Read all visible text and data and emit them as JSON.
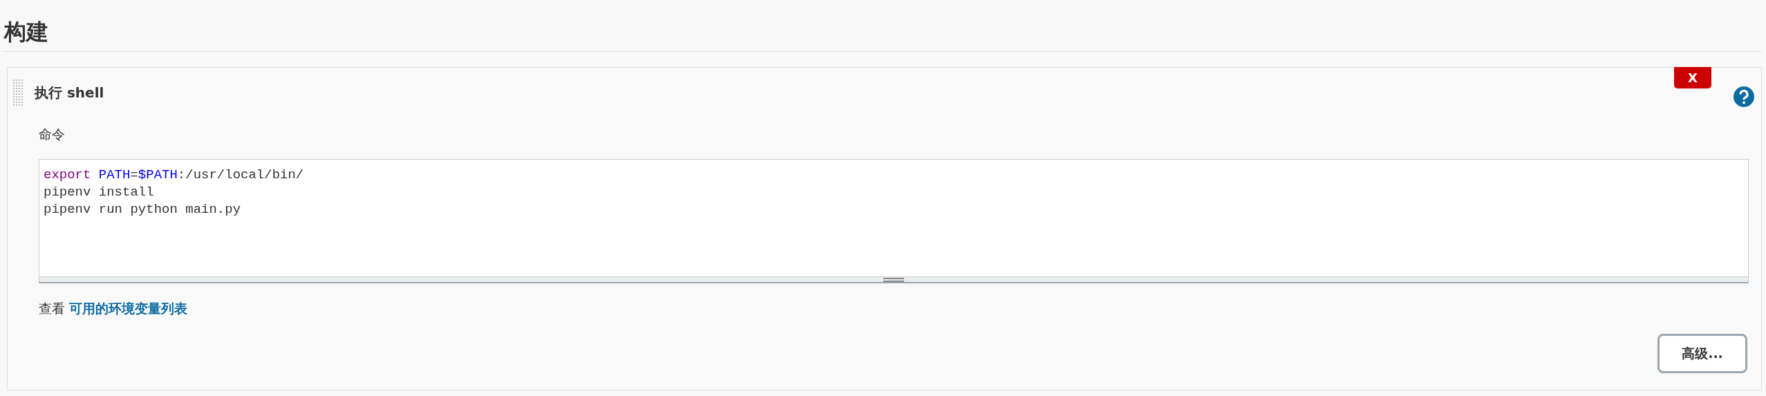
{
  "section": {
    "title": "构建"
  },
  "step": {
    "title": "执行 shell",
    "delete_label": "X",
    "field_label": "命令",
    "code_lines": [
      [
        {
          "kind": "keyword",
          "text": "export"
        },
        {
          "kind": "variable",
          "text": "PATH",
          "gap_before": true
        },
        {
          "kind": "plain",
          "text": "="
        },
        {
          "kind": "variable",
          "text": "$PATH"
        },
        {
          "kind": "plain",
          "text": ":/usr/local/bin/"
        }
      ],
      [
        {
          "kind": "plain",
          "text": "pipenv install"
        }
      ],
      [
        {
          "kind": "plain",
          "text": "pipenv run python main.py"
        }
      ]
    ],
    "hint_prefix": "查看",
    "hint_link": "可用的环境变量列表",
    "advanced_button": "高级..."
  }
}
